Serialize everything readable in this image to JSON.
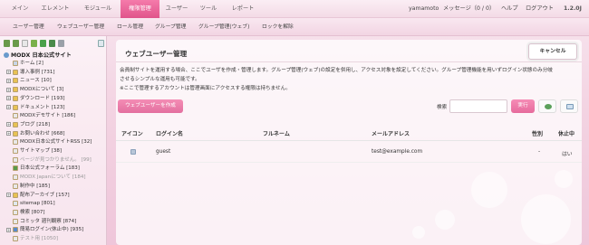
{
  "topnav": {
    "items": [
      "メイン",
      "エレメント",
      "モジュール",
      "権限管理",
      "ユーザー",
      "ツール",
      "レポート"
    ],
    "active_index": 3,
    "username": "yamamoto",
    "messages": "メッセージ（0 / 0）",
    "help": "ヘルプ",
    "logout": "ログアウト",
    "version": "1.2.0J"
  },
  "subnav": {
    "items": [
      "ユーザー管理",
      "ウェブユーザー管理",
      "ロール管理",
      "グループ管理",
      "グループ管理(ウェブ)",
      "ロックを解除"
    ]
  },
  "tree": {
    "root": "MODX 日本公式サイト",
    "nodes": [
      {
        "label": "ホーム [2]",
        "expander": ""
      },
      {
        "label": "導入事例 [731]",
        "expander": "+"
      },
      {
        "label": "ニュース [10]",
        "expander": "+"
      },
      {
        "label": "MODXについて [3]",
        "expander": "+"
      },
      {
        "label": "ダウンロード [193]",
        "expander": "+"
      },
      {
        "label": "ドキュメント [123]",
        "expander": "+"
      },
      {
        "label": "MODXデモサイト [186]",
        "expander": ""
      },
      {
        "label": "ブログ [218]",
        "expander": "+"
      },
      {
        "label": "お問い合わせ [668]",
        "expander": "+"
      },
      {
        "label": "MODX日本公式サイトRSS [32]",
        "expander": ""
      },
      {
        "label": "サイトマップ [38]",
        "expander": ""
      },
      {
        "label": "ページが見つかりません。 [99]",
        "expander": ""
      },
      {
        "label": "日本公式フォーラム [183]",
        "expander": ""
      },
      {
        "label": "MODX Japanについて [184]",
        "expander": ""
      },
      {
        "label": "制作中 [185]",
        "expander": ""
      },
      {
        "label": "配布アーカイブ [157]",
        "expander": "+"
      },
      {
        "label": "sitemap [801]",
        "expander": ""
      },
      {
        "label": "検索 [807]",
        "expander": ""
      },
      {
        "label": "コミッタ 週刊観察 [874]",
        "expander": ""
      },
      {
        "label": "簡易ログイン(休止中) [935]",
        "expander": "+"
      },
      {
        "label": "テスト用 [1050]",
        "expander": ""
      }
    ]
  },
  "main": {
    "title": "ウェブユーザー管理",
    "cancel_label": "キャンセル",
    "desc_lines": [
      "会員制サイトを運用する場合、ここでユーザを作成・管理します。グループ管理(ウェブ)の設定を併用し、アクセス対象を設定してください。グループ管理機能を用いずログイン状態のみ分岐",
      "させるシンプルな運用も可能です。",
      "※ここで管理するアカウントは管理画面にアクセスする権限は持ちません。"
    ],
    "create_label": "ウェブユーザーを作成",
    "search_label": "検索",
    "search_value": "",
    "run_label": "実行",
    "columns": [
      "アイコン",
      "ログイン名",
      "フルネーム",
      "メールアドレス",
      "性別",
      "休止中"
    ],
    "rows": [
      {
        "login": "guest",
        "fullname": "",
        "email": "test@example.com",
        "gender": "-",
        "blocked": "はい"
      }
    ]
  },
  "colors": {
    "accent": "#e0548b",
    "accent_light": "#f48db5"
  }
}
